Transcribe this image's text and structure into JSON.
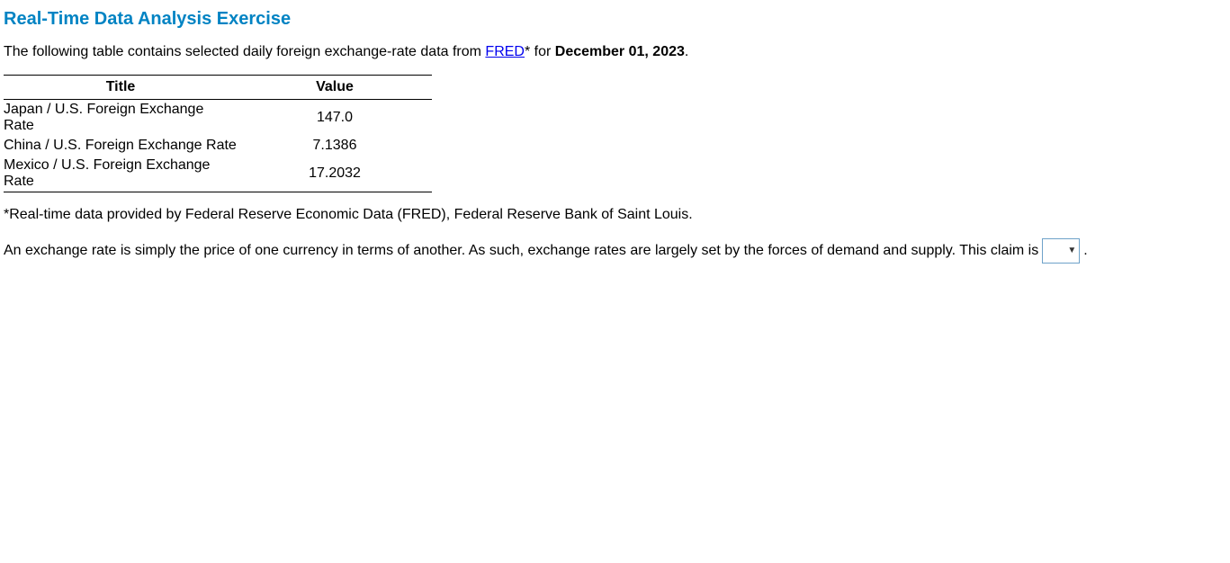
{
  "heading": "Real-Time Data Analysis Exercise",
  "intro": {
    "prefix": "The following table contains selected daily foreign exchange-rate data from ",
    "link_text": "FRED",
    "mid": "* for ",
    "date": "December 01, 2023",
    "suffix": "."
  },
  "table": {
    "headers": {
      "title": "Title",
      "value": "Value"
    },
    "rows": [
      {
        "title": "Japan / U.S. Foreign Exchange Rate",
        "value": "147.0"
      },
      {
        "title": "China / U.S. Foreign Exchange Rate",
        "value": "7.1386"
      },
      {
        "title": "Mexico / U.S. Foreign Exchange Rate",
        "value": "17.2032"
      }
    ]
  },
  "footnote": "*Real-time data provided by Federal Reserve Economic Data (FRED), Federal Reserve Bank of Saint Louis.",
  "question": {
    "text": "An exchange rate is simply the price of one currency in terms of another. As such, exchange rates are largely set by the forces of demand and supply. This claim is",
    "trailing": "."
  },
  "dropdown": {
    "selected": ""
  }
}
